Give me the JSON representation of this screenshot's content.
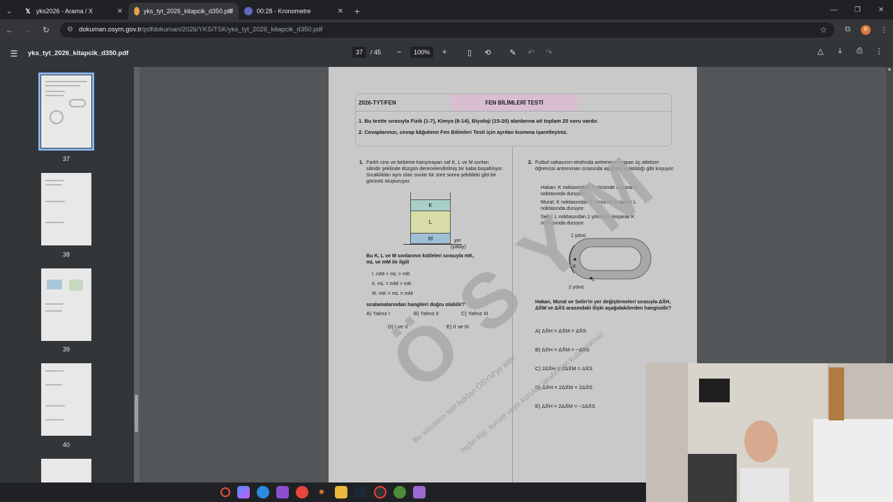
{
  "tabs": [
    {
      "title": "yks2026 - Arama / X",
      "icon": "x-logo-icon",
      "active": false
    },
    {
      "title": "yks_tyt_2026_kitapcik_d350.pdf",
      "icon": "pdf-icon",
      "active": true
    },
    {
      "title": "00:28 - Kronometre",
      "icon": "stopwatch-icon",
      "active": false
    }
  ],
  "address": {
    "host": "dokuman.osym.gov.tr",
    "path": "/pdfdokuman/2026/YKS/TSK/yks_tyt_2026_kitapcik_d350.pdf"
  },
  "profile_initial": "B",
  "pdf": {
    "filename": "yks_tyt_2026_kitapcik_d350.pdf",
    "current_page": "37",
    "total_pages": "/ 45",
    "zoom": "100%"
  },
  "thumbnails": [
    "37",
    "38",
    "39",
    "40"
  ],
  "exam": {
    "code": "2026-TYT/FEN",
    "test_name": "FEN BİLİMLERİ TESTİ",
    "instruction1": "1. Bu testte sırasıyla Fizik (1-7), Kimya (8-14), Biyoloji (15-20) alanlarına ait toplam 20 soru vardır.",
    "instruction2": "2. Cevaplarınızı, cevap kâğıdının Fen Bilimleri Testi için ayrılan kısmına işaretleyiniz."
  },
  "q1": {
    "number": "1.",
    "text": "Farklı cins ve birbirine karışmayan saf K, L ve M sıvıları silindir şeklinde düzgün derecelendirilmiş bir kaba boşaltılıyor. Sıcaklıkları aynı olan sıvılar bir süre sonra şekildeki gibi bir görüntü oluşturuyor.",
    "liquids": [
      "K",
      "L",
      "M"
    ],
    "ground_label": "yer",
    "ground_sub": "(yatay)",
    "stem": "Bu K, L ve M sıvılarının kütleleri sırasıyla mK, mL ve mM ile ilgili",
    "items": [
      "I.   mM > mL > mK",
      "II.  mL = mM > mK",
      "III. mK = mL = mM"
    ],
    "ask": "sıralamalarından hangileri doğru olabilir?",
    "options": [
      "A) Yalnız I",
      "B) Yalnız II",
      "C) Yalnız III",
      "D) I ve II",
      "E) II ve III"
    ]
  },
  "q2": {
    "number": "2.",
    "text": "Futbol sahasının etrafında antrenman yapan üç atletizm öğrencisi antrenman sırasında aşağıda anlatıldığı gibi koşuyor.",
    "bullets": [
      "Hakan: K noktasından 1 yönünde koşarak L noktasında duruyor.",
      "Murat: K noktasından 2 yönünde koşarak L noktasında duruyor.",
      "Selin: L noktasından 1 yönünde koşarak K noktasında duruyor."
    ],
    "dir1": "1 yönü",
    "dir2": "2 yönü",
    "pointK": "K",
    "pointL": "L",
    "stem": "Hakan, Murat ve Selin'in yer değiştirmeleri sırasıyla ΔX̄H, ΔX̄M ve ΔX̄S arasındaki ilişki aşağıdakilerden hangisidir?",
    "options": [
      "A) ΔX̄H = ΔX̄M = ΔX̄S",
      "B) ΔX̄H = ΔX̄M = −ΔX̄S",
      "C) 2ΔX̄H = 2ΔX̄M = ΔX̄S",
      "D) ΔX̄H = 2ΔX̄M = 2ΔX̄S",
      "E) ΔX̄H = 2ΔX̄M = −2ΔX̄S"
    ]
  },
  "watermark": {
    "big": "ÖSYM",
    "small1": "Bu soruların telif hakları ÖSYM'ye aittir.",
    "small2": "hiçbir kişi, kurum veya kuruluş tarafından kullanılamaz."
  },
  "colors": {
    "liquid_K": "#a9cfc9",
    "liquid_L": "#d9dca6",
    "liquid_M": "#9fbfd6",
    "test_header": "#d8bed0"
  }
}
